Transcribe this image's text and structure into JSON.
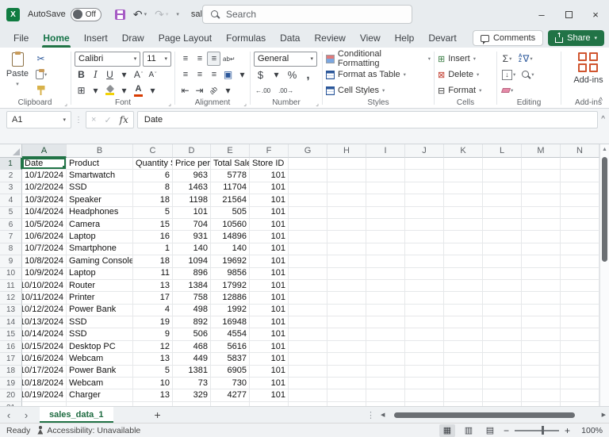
{
  "icons": {
    "app": "X",
    "undo": "↶",
    "redo": "↷",
    "dropdown": "▾",
    "minimize": "–",
    "close": "×",
    "scissors": "✂",
    "bold": "B",
    "italic": "I",
    "underline": "U",
    "grow_font": "A",
    "shrink_font": "A",
    "grow_mark": "ˆ",
    "shrink_mark": "ˇ",
    "borders": "⊞",
    "font_color_letter": "A",
    "align_lines": "≡",
    "wrap_text": "ab↵",
    "merge_center": "▣",
    "indent_dec": "⇤",
    "indent_inc": "⇥",
    "orientation": "ab",
    "dollar": "$",
    "percent": "%",
    "comma": ",",
    "inc_decimal": "←.00",
    "dec_decimal": ".00→",
    "sum": "Σ",
    "sort_a": "A",
    "sort_z": "Z",
    "funnel": "∇",
    "fill_down": "↓",
    "insert_cells": "⊞",
    "delete_cells": "⊠",
    "format_cells": "⊟",
    "dots_vertical": "⋮",
    "dots_more": "⋮",
    "launcher": "⌟",
    "collapse": "^",
    "expand_formula_bar": "^",
    "scroll_up": "▲",
    "scroll_left": "◀",
    "scroll_right": "▶",
    "prev_sheet": "‹",
    "next_sheet": "›",
    "add_sheet": "+",
    "view_normal": "▦",
    "view_page_layout": "▥",
    "view_page_break": "▤",
    "zoom_out": "−",
    "zoom_in": "+"
  },
  "titlebar": {
    "autosave_label": "AutoSave",
    "autosave_state": "Off",
    "filename": "sales_da...",
    "search_placeholder": "Search"
  },
  "ribbon_tabs": [
    "File",
    "Home",
    "Insert",
    "Draw",
    "Page Layout",
    "Formulas",
    "Data",
    "Review",
    "View",
    "Help",
    "Devart"
  ],
  "active_tab_index": 1,
  "top_actions": {
    "comments": "Comments",
    "share": "Share"
  },
  "ribbon": {
    "clipboard": {
      "label": "Clipboard",
      "paste": "Paste"
    },
    "font": {
      "label": "Font",
      "font_name": "Calibri",
      "font_size": "11"
    },
    "alignment": {
      "label": "Alignment"
    },
    "number": {
      "label": "Number",
      "format": "General"
    },
    "styles": {
      "label": "Styles",
      "items": [
        "Conditional Formatting",
        "Format as Table",
        "Cell Styles"
      ]
    },
    "cells": {
      "label": "Cells",
      "items": [
        "Insert",
        "Delete",
        "Format"
      ]
    },
    "editing": {
      "label": "Editing"
    },
    "addins": {
      "label": "Add-ins",
      "button": "Add-ins"
    }
  },
  "formula_bar": {
    "name_box": "A1",
    "value": "Date"
  },
  "grid": {
    "columns": [
      "A",
      "B",
      "C",
      "D",
      "E",
      "F",
      "G",
      "H",
      "I",
      "J",
      "K",
      "L",
      "M",
      "N"
    ],
    "header_row": [
      "Date",
      "Product",
      "Quantity Sold",
      "Price per Unit",
      "Total Sales",
      "Store ID"
    ],
    "rows": [
      [
        "10/1/2024",
        "Smartwatch",
        6,
        963,
        5778,
        101
      ],
      [
        "10/2/2024",
        "SSD",
        8,
        1463,
        11704,
        101
      ],
      [
        "10/3/2024",
        "Speaker",
        18,
        1198,
        21564,
        101
      ],
      [
        "10/4/2024",
        "Headphones",
        5,
        101,
        505,
        101
      ],
      [
        "10/5/2024",
        "Camera",
        15,
        704,
        10560,
        101
      ],
      [
        "10/6/2024",
        "Laptop",
        16,
        931,
        14896,
        101
      ],
      [
        "10/7/2024",
        "Smartphone",
        1,
        140,
        140,
        101
      ],
      [
        "10/8/2024",
        "Gaming Console",
        18,
        1094,
        19692,
        101
      ],
      [
        "10/9/2024",
        "Laptop",
        11,
        896,
        9856,
        101
      ],
      [
        "10/10/2024",
        "Router",
        13,
        1384,
        17992,
        101
      ],
      [
        "10/11/2024",
        "Printer",
        17,
        758,
        12886,
        101
      ],
      [
        "10/12/2024",
        "Power Bank",
        4,
        498,
        1992,
        101
      ],
      [
        "10/13/2024",
        "SSD",
        19,
        892,
        16948,
        101
      ],
      [
        "10/14/2024",
        "SSD",
        9,
        506,
        4554,
        101
      ],
      [
        "10/15/2024",
        "Desktop PC",
        12,
        468,
        5616,
        101
      ],
      [
        "10/16/2024",
        "Webcam",
        13,
        449,
        5837,
        101
      ],
      [
        "10/17/2024",
        "Power Bank",
        5,
        1381,
        6905,
        101
      ],
      [
        "10/18/2024",
        "Webcam",
        10,
        73,
        730,
        101
      ],
      [
        "10/19/2024",
        "Charger",
        13,
        329,
        4277,
        101
      ]
    ]
  },
  "sheet": {
    "active_tab": "sales_data_1"
  },
  "status": {
    "mode": "Ready",
    "accessibility": "Accessibility: Unavailable",
    "zoom": "100%"
  }
}
